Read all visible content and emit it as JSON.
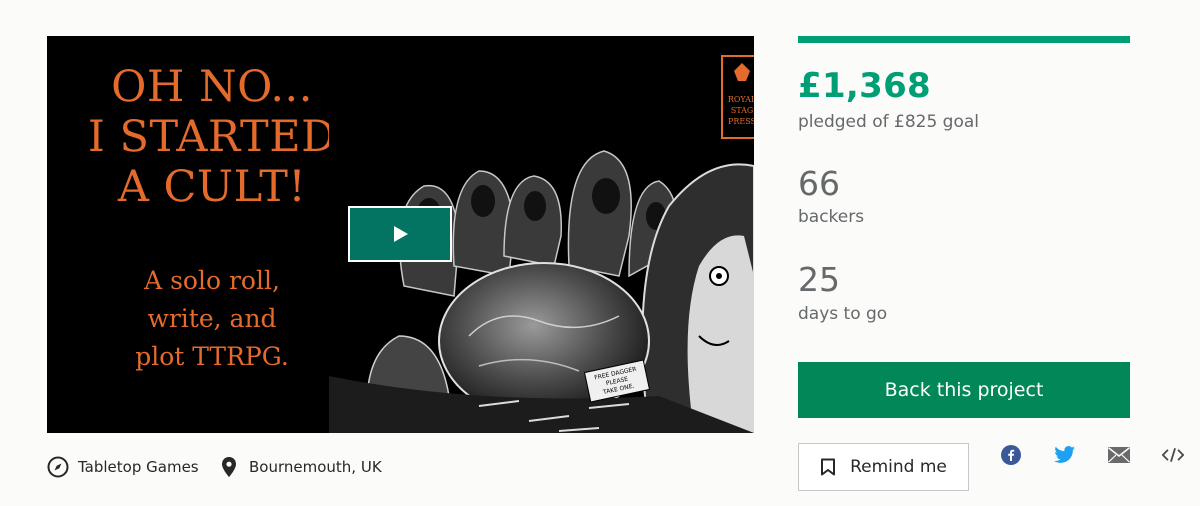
{
  "video": {
    "title_lines": [
      "OH NO...",
      "I STARTED",
      "A CULT!"
    ],
    "subtitle_lines": [
      "A solo roll,",
      "write, and",
      "plot TTRPG."
    ],
    "publisher_logo_text": [
      "ROYAL",
      "STAG",
      "PRESS"
    ],
    "sign_text": [
      "FREE DAGGER",
      "PLEASE",
      "TAKE ONE."
    ]
  },
  "meta": {
    "category": "Tabletop Games",
    "location": "Bournemouth, UK"
  },
  "stats": {
    "funded_fraction": 1.0,
    "amount": "£1,368",
    "pledged_label": "pledged of £825 goal",
    "backers": "66",
    "backers_label": "backers",
    "days": "25",
    "days_label": "days to go"
  },
  "actions": {
    "back_label": "Back this project",
    "remind_label": "Remind me"
  },
  "share_icons": [
    "facebook-icon",
    "twitter-icon",
    "email-icon",
    "embed-icon"
  ],
  "colors": {
    "accent": "#009e74",
    "button": "#028858",
    "title_orange": "#e46b2b",
    "play_button": "#037362"
  }
}
